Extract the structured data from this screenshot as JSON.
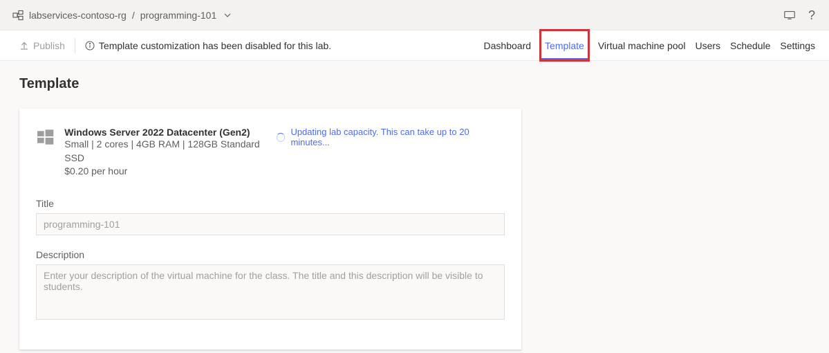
{
  "breadcrumbs": {
    "rg": "labservices-contoso-rg",
    "sep": "/",
    "lab": "programming-101"
  },
  "commandBar": {
    "publish_label": "Publish",
    "notice": "Template customization has been disabled for this lab."
  },
  "tabs": {
    "dashboard": "Dashboard",
    "template": "Template",
    "vmpool": "Virtual machine pool",
    "users": "Users",
    "schedule": "Schedule",
    "settings": "Settings"
  },
  "page": {
    "heading": "Template"
  },
  "vm": {
    "title": "Windows Server 2022 Datacenter (Gen2)",
    "meta": "Small | 2 cores | 4GB RAM | 128GB Standard SSD",
    "price": "$0.20 per hour"
  },
  "status": {
    "message": "Updating lab capacity. This can take up to 20 minutes..."
  },
  "fields": {
    "title_label": "Title",
    "title_value": "programming-101",
    "description_label": "Description",
    "description_placeholder": "Enter your description of the virtual machine for the class. The title and this description will be visible to students."
  },
  "colors": {
    "accent": "#4f6bed",
    "highlight": "#d13438"
  }
}
